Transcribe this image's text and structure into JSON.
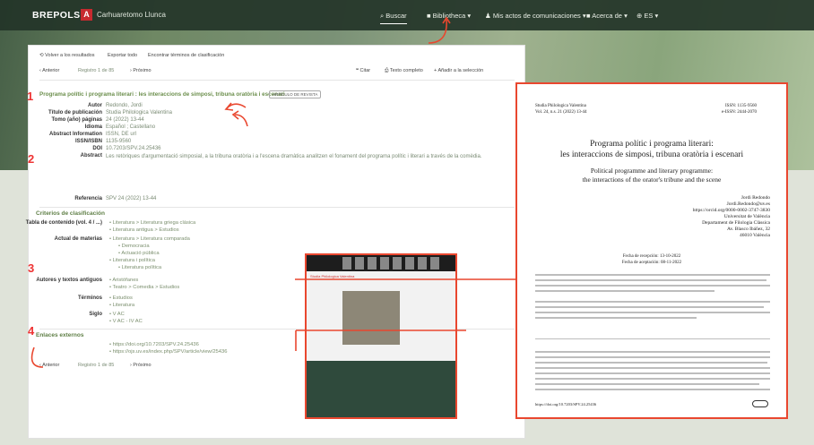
{
  "header": {
    "brand": "BREPOLS",
    "logo_letter": "A",
    "site": "Carhuaretomo Llunca",
    "nav": [
      {
        "label": "Buscar",
        "icon": "search-icon"
      },
      {
        "label": "Bibliotheca"
      },
      {
        "label": "Mis actos de comunicaciones"
      },
      {
        "label": "Acerca de"
      },
      {
        "label": "ES"
      }
    ]
  },
  "actions": {
    "link1": "Volver a los resultados",
    "link2": "Exportar todo",
    "link3": "Encontrar términos de clasificación"
  },
  "pager": {
    "prev": "Anterior",
    "info": "Registro 1 de 85",
    "next": "Próximo",
    "count_top": "1 / 85",
    "count_bottom": "1 / 85"
  },
  "tools": {
    "cite": "Citar",
    "print": "Texto completo",
    "add": "Añadir a la selección"
  },
  "record": {
    "title": "Programa polític i programa literari : les interaccions de simposi, tribuna oratòria i escenari",
    "tag": "ARTÍCULO DE REVISTA",
    "fields": [
      {
        "label": "Autor",
        "value": "Redondo, Jordi"
      },
      {
        "label": "Título de publicación",
        "value": "Studia Philologica Valentina"
      },
      {
        "label": "Tomo (año) páginas",
        "value": "24 (2022) 13-44"
      },
      {
        "label": "Idioma",
        "value": "Español ; Castellano"
      },
      {
        "label": "Abstract Information",
        "value": "ISSN, DE url"
      },
      {
        "label": "ISSN/ISBN",
        "value": "1135-9560"
      },
      {
        "label": "DOI",
        "value": "10.7203/SPV.24.25436"
      },
      {
        "label": "Abstract",
        "value": "Les retòriques d'argumentació simposial, a la tribuna oratòria i a l'escena dramàtica analitzen el fonament del programa polític i literari a través de la comèdia."
      },
      {
        "label": "Referencia",
        "value": "SPV 24 (2022) 13-44"
      }
    ]
  },
  "classification": {
    "heading": "Criterios de clasificación",
    "rows": [
      {
        "label": "Tabla de contenido (vol. 4 / ...)",
        "items": [
          "Literatura > Literatura griega clásica",
          "Literatura antigua > Estudios"
        ]
      },
      {
        "label": "Actual de materias",
        "items": [
          "Literatura > Literatura comparada",
          "Democracia",
          "Actuació pública",
          "Literatura i política",
          "Literatura política"
        ]
      },
      {
        "label": "Autores y textos antiguos",
        "items": [
          "Aristófanes",
          "Teatro > Comedia > Estudios"
        ]
      },
      {
        "label": "Términos",
        "items": [
          "Estudios",
          "Literatura"
        ]
      },
      {
        "label": "Siglo",
        "items": [
          "V AC",
          "V AC - IV AC"
        ]
      }
    ]
  },
  "links": {
    "heading": "Enlaces externos",
    "items": [
      "https://doi.org/10.7203/SPV.24.25436",
      "https://ojs.uv.es/index.php/SPV/article/view/25436"
    ]
  },
  "annotations": {
    "n1": "1",
    "n2": "2",
    "n3": "3",
    "n4": "4"
  },
  "pdf": {
    "journal": "Studia Philologica Valentina",
    "vol": "Vol. 24, n.s. 21 (2022) 13-44",
    "issn1": "ISSN: 1135-9560",
    "issn2": "e-ISSN: 2444-2070",
    "title1": "Programa polític i programa literari:",
    "title2": "les interaccions de simposi, tribuna oratòria i escenari",
    "sub1": "Political programme and literary programme:",
    "sub2": "the interactions of the orator's tribune and the scene",
    "author": "Jordi Redondo",
    "email": "Jordi.Redondo@uv.es",
    "orcid": "https://orcid.org/0000-0002-3747-3830",
    "uni": "Universitat de València",
    "dept": "Departament de Filologia Clàssica",
    "addr": "Av. Blasco Ibáñez, 32",
    "city": "46010 València",
    "date1": "Fecha de recepción: 13-10-2022",
    "date2": "Fecha de aceptación: 08-11-2022",
    "doi": "https://doi.org/10.7203/SPV.24.25436"
  },
  "web": {
    "title": "Studia Philologica Valentina"
  },
  "colors": {
    "accent": "#6c8f4d",
    "annotation": "#e9472f",
    "header": "#233428"
  }
}
